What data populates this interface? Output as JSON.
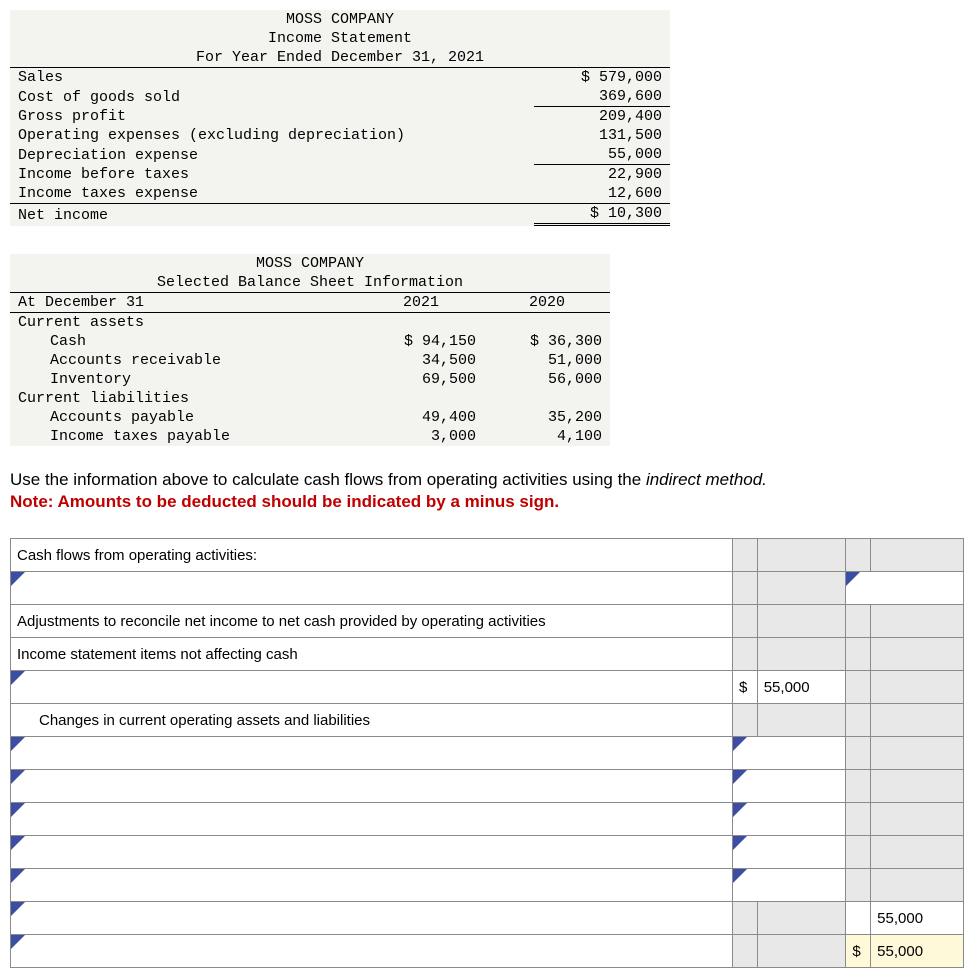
{
  "income_statement": {
    "company": "MOSS COMPANY",
    "title": "Income Statement",
    "period": "For Year Ended December 31, 2021",
    "rows": {
      "sales_label": "Sales",
      "sales_val": "$ 579,000",
      "cogs_label": "Cost of goods sold",
      "cogs_val": "369,600",
      "gp_label": "Gross profit",
      "gp_val": "209,400",
      "opex_label": "Operating expenses (excluding depreciation)",
      "opex_val": "131,500",
      "dep_label": "Depreciation expense",
      "dep_val": "55,000",
      "ibt_label": "Income before taxes",
      "ibt_val": "22,900",
      "itx_label": "Income taxes expense",
      "itx_val": "12,600",
      "ni_label": "Net income",
      "ni_val": "$ 10,300"
    }
  },
  "balance_sheet": {
    "company": "MOSS COMPANY",
    "title": "Selected Balance Sheet Information",
    "col_date": "At December 31",
    "col_2021": "2021",
    "col_2020": "2020",
    "sec_ca": "Current assets",
    "cash_label": "Cash",
    "cash_21": "$ 94,150",
    "cash_20": "$ 36,300",
    "ar_label": "Accounts receivable",
    "ar_21": "34,500",
    "ar_20": "51,000",
    "inv_label": "Inventory",
    "inv_21": "69,500",
    "inv_20": "56,000",
    "sec_cl": "Current liabilities",
    "ap_label": "Accounts payable",
    "ap_21": "49,400",
    "ap_20": "35,200",
    "itp_label": "Income taxes payable",
    "itp_21": "3,000",
    "itp_20": "4,100"
  },
  "prompt": {
    "line1a": "Use the information above to calculate cash flows from operating activities using the ",
    "line1b": "indirect method.",
    "line2": "Note: Amounts to be deducted should be indicated by a minus sign."
  },
  "worksheet": {
    "r1": "Cash flows from operating activities:",
    "r3": "Adjustments to reconcile net income to net cash provided by operating activities",
    "r4": "Income statement items not affecting cash",
    "r5_sym": "$",
    "r5_val": "55,000",
    "r6": "Changes in current operating assets and liabilities",
    "r12_val": "55,000",
    "r13_sym": "$",
    "r13_val": "55,000"
  },
  "chart_data": {
    "type": "table",
    "title": "MOSS COMPANY financial data",
    "income_statement": {
      "Sales": 579000,
      "Cost of goods sold": 369600,
      "Gross profit": 209400,
      "Operating expenses (excluding depreciation)": 131500,
      "Depreciation expense": 55000,
      "Income before taxes": 22900,
      "Income taxes expense": 12600,
      "Net income": 10300
    },
    "balance_sheet": {
      "columns": [
        "2021",
        "2020"
      ],
      "Cash": [
        94150,
        36300
      ],
      "Accounts receivable": [
        34500,
        51000
      ],
      "Inventory": [
        69500,
        56000
      ],
      "Accounts payable": [
        49400,
        35200
      ],
      "Income taxes payable": [
        3000,
        4100
      ]
    },
    "worksheet_given": {
      "Depreciation adjustment": 55000,
      "Subtotal": 55000,
      "Net cash total": 55000
    }
  }
}
